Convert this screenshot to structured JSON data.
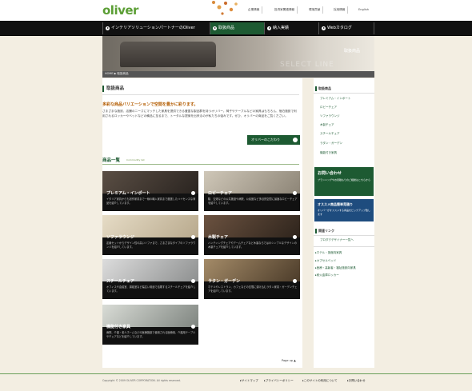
{
  "header": {
    "logo": "oliver",
    "links": [
      "企業情報",
      "投資家関連情報",
      "環境貢献",
      "採用情報",
      "English"
    ]
  },
  "nav": {
    "items": [
      "インテリアソリューションパートナーのOliver",
      "取扱商品",
      "納入実績",
      "Webカタログ"
    ],
    "active_index": 1
  },
  "hero": {
    "label": "取扱商品",
    "watermark": "SELECT LINE"
  },
  "breadcrumb": "HOME ▶ 取扱商品",
  "main": {
    "title": "取扱商品",
    "lead": "多彩な商品バリエーションで空間を豊かに彩ります。",
    "intro": "さまざまな施設、店舗のニーズにマッチした家具を提供できる豊富な製品群を持つオリバー。椅子やテーブルなどの家具はもちろん、宿泊施設で利用されるロッカーやベッドなどの備品に至るまで、トータルな提案を出来るのが私たちの強みです。ぜひ、オリバーの商品をご覧ください。",
    "kodawari_button": "オリバーのこだわり",
    "list_title": "商品一覧",
    "list_subtitle": "Commodity list",
    "page_up": "Page up"
  },
  "cards": [
    {
      "title": "プレミアム・インポート",
      "desc": "イタリア家具からも創作家具まで一線の輸入家具まで厳選したハイセンスな商品を紹介しています。"
    },
    {
      "title": "ロビーチェア",
      "desc": "駅、空港などの公共施設や病院、公民館など多目的空間に最適なロビーチェアを紹介しています。"
    },
    {
      "title": "ソファラウンジ",
      "desc": "定番セットからデザイン性の高いソファまで、さまざまなタイプのソファラウンジを紹介しています。"
    },
    {
      "title": "木製チェア",
      "desc": "ハンティングチェアやアームチェアなど木製ならではのシンプルなデザインの木製チェアを紹介しています。"
    },
    {
      "title": "スチールチェア",
      "desc": "オフィスや会議室、講義室など幅広い用途で活躍するスチールチェアを紹介しています。"
    },
    {
      "title": "ラタン・ガーデン",
      "desc": "ホテルやレストラン、カフェなどの空間に溶け込むラタン家具・ガーデンチェアを紹介しています。"
    },
    {
      "title": "機能付き家具",
      "desc": "病院、介護・老人ホームなどの医療施設で使用される医療用、介護用テーブルやチェアなどを紹介しています。"
    }
  ],
  "sidebar": {
    "title": "取扱商品",
    "items": [
      "プレミアム・インポート",
      "ロビーチェア",
      "ソファラウンジ",
      "木製チェア",
      "スチールチェア",
      "ラタン・ガーデン",
      "機能付き家具"
    ],
    "contact_title": "お問い合わせ",
    "contact_text": "プランニングやお見積もりのご相談はこちらから",
    "simple_title": "オススメ商品簡単見積り",
    "simple_text": "オリバーがオススメする商品をピックアップ致します",
    "related_title": "関連リンク",
    "related": [
      "プロダクデザイナー一覧へ",
      "ホテル・旅館向家具",
      "カプセルベッド",
      "医療・高齢者・福祉施設向家具",
      "耐火金庫ロッカー"
    ]
  },
  "footer": {
    "copyright": "Copyright © 2009 OLIVER CORPORATION. All rights reserved.",
    "links": [
      "サイトマップ",
      "プライバシーポリシー",
      "このサイトの利用について",
      "お問い合わせ"
    ]
  },
  "colors": {
    "accent": "#1d5a32",
    "brand": "#5b9e35",
    "background": "#f3eee2",
    "nav": "#111111"
  }
}
